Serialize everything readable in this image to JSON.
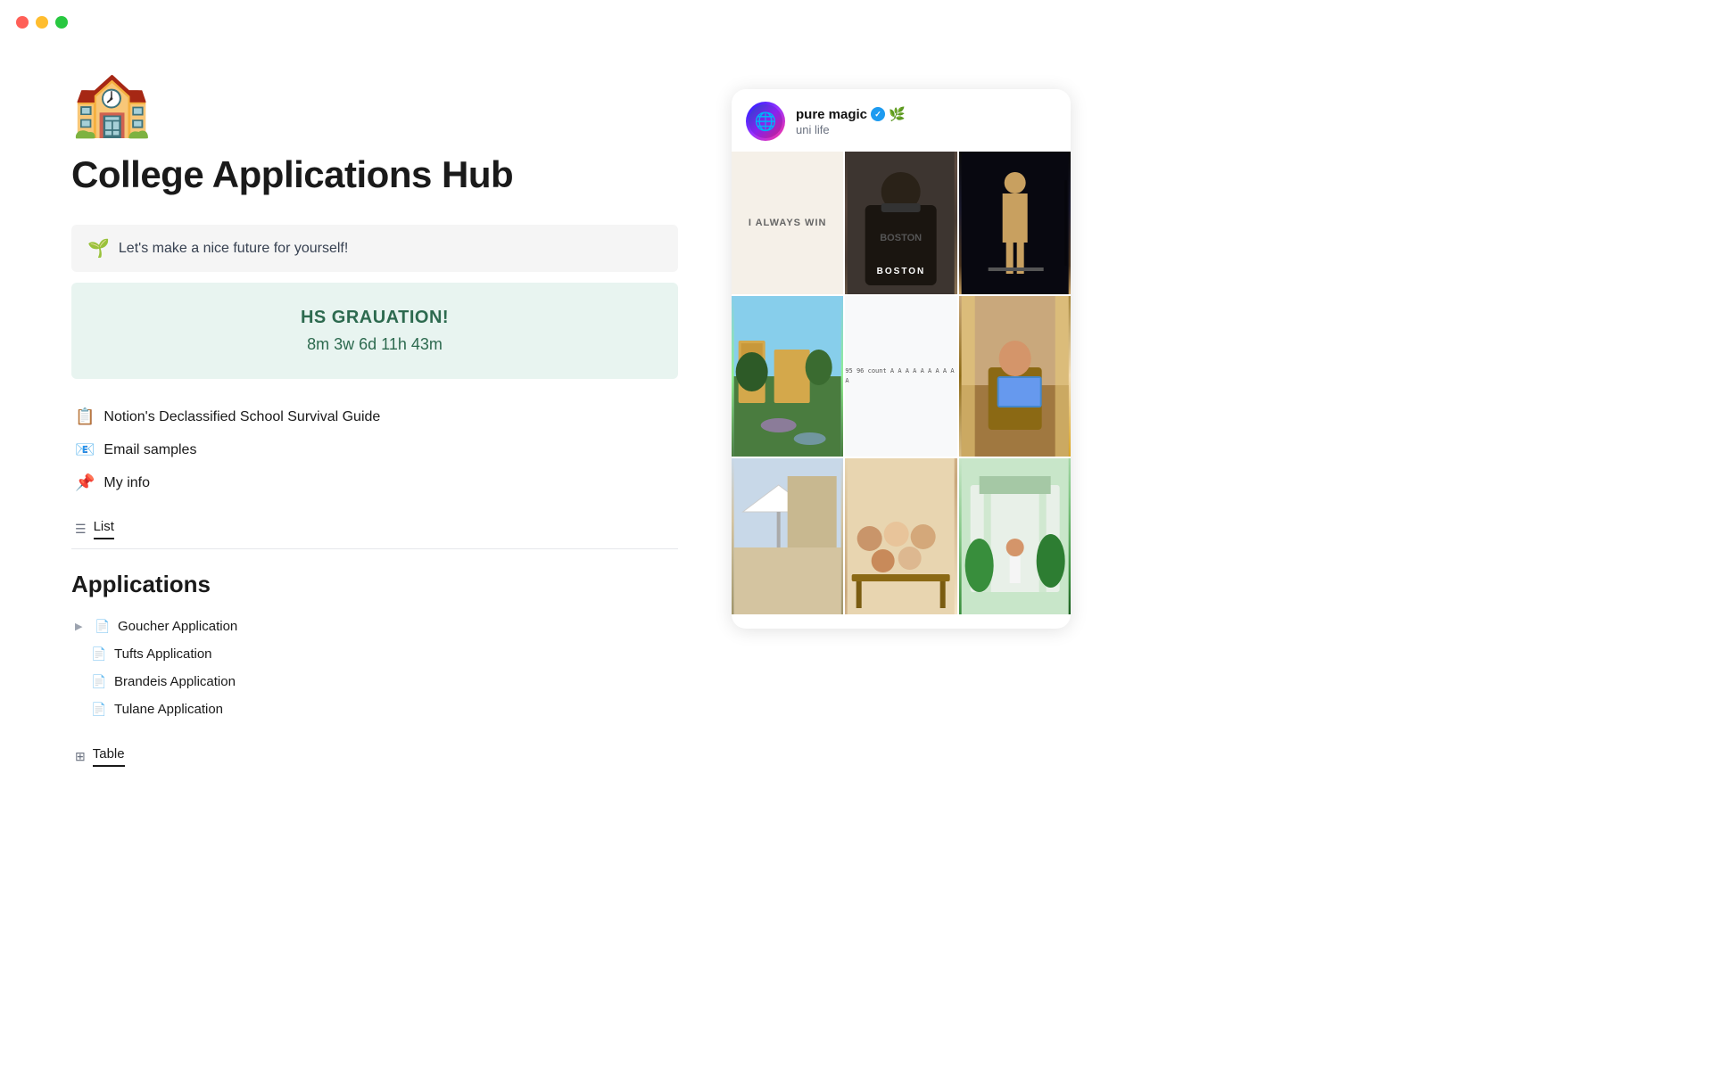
{
  "window": {
    "title": "College Applications Hub"
  },
  "traffic_lights": {
    "red": "close",
    "yellow": "minimize",
    "green": "fullscreen"
  },
  "page": {
    "icon": "🏫",
    "title": "College Applications Hub",
    "callout": {
      "icon": "🌱",
      "text": "Let's make a nice future for yourself!"
    },
    "countdown": {
      "title": "HS GRAUATION!",
      "time": "8m 3w 6d 11h 43m"
    },
    "links": [
      {
        "emoji": "📋",
        "label": "Notion's Declassified School Survival Guide"
      },
      {
        "emoji": "📧",
        "label": "Email samples"
      },
      {
        "emoji": "📌",
        "label": "My info"
      }
    ],
    "list_view_label": "List",
    "applications_heading": "Applications",
    "applications": [
      {
        "name": "Goucher Application",
        "has_toggle": true
      },
      {
        "name": "Tufts Application",
        "has_toggle": false
      },
      {
        "name": "Brandeis Application",
        "has_toggle": false
      },
      {
        "name": "Tulane Application",
        "has_toggle": false
      }
    ],
    "table_view_label": "Table"
  },
  "social_card": {
    "username": "pure magic",
    "verified": true,
    "emojis": "✅ 🌿",
    "subtitle": "uni life",
    "photos": {
      "row1": [
        "I ALWAYS WIN",
        "BOSTON hoodie photo",
        "Speaker on stage"
      ],
      "row2": [
        "Campus lawn photo",
        "Spreadsheet grades",
        "Person working at laptop"
      ],
      "row3": [
        "Outdoor market",
        "Group of people",
        "Garden/courtyard"
      ]
    },
    "spreadsheet_data": "95 96 count\nA  A\nA  A\nA  A\nA  A\nA  A"
  }
}
